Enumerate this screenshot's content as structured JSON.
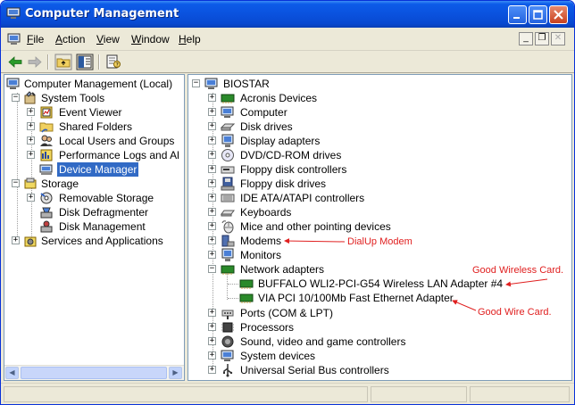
{
  "window": {
    "title": "Computer Management"
  },
  "menu": {
    "items": [
      {
        "label": "File",
        "accel": "F",
        "rest": "ile"
      },
      {
        "label": "Action",
        "accel": "A",
        "rest": "ction"
      },
      {
        "label": "View",
        "accel": "V",
        "rest": "iew"
      },
      {
        "label": "Window",
        "accel": "W",
        "rest": "indow"
      },
      {
        "label": "Help",
        "accel": "H",
        "rest": "elp"
      }
    ]
  },
  "left_tree": {
    "root": "Computer Management (Local)",
    "system_tools": "System Tools",
    "event_viewer": "Event Viewer",
    "shared_folders": "Shared Folders",
    "local_users": "Local Users and Groups",
    "performance": "Performance Logs and Al",
    "device_manager": "Device Manager",
    "storage": "Storage",
    "removable_storage": "Removable Storage",
    "disk_defrag": "Disk Defragmenter",
    "disk_management": "Disk Management",
    "services": "Services and Applications"
  },
  "right_tree": {
    "root": "BIOSTAR",
    "categories": [
      "Acronis Devices",
      "Computer",
      "Disk drives",
      "Display adapters",
      "DVD/CD-ROM drives",
      "Floppy disk controllers",
      "Floppy disk drives",
      "IDE ATA/ATAPI controllers",
      "Keyboards",
      "Mice and other pointing devices",
      "Modems",
      "Monitors",
      "Network adapters"
    ],
    "network_children": [
      "BUFFALO WLI2-PCI-G54 Wireless LAN Adapter #4",
      "VIA PCI 10/100Mb Fast Ethernet Adapter"
    ],
    "categories_after": [
      "Ports (COM & LPT)",
      "Processors",
      "Sound, video and game controllers",
      "System devices",
      "Universal Serial Bus controllers"
    ]
  },
  "annotations": {
    "dialup": "DialUp Modem",
    "wireless": "Good Wireless Card.",
    "wired": "Good Wire Card."
  },
  "colors": {
    "titlebar": "#0a52de",
    "selection": "#316ac5",
    "annotation": "#e02020"
  }
}
